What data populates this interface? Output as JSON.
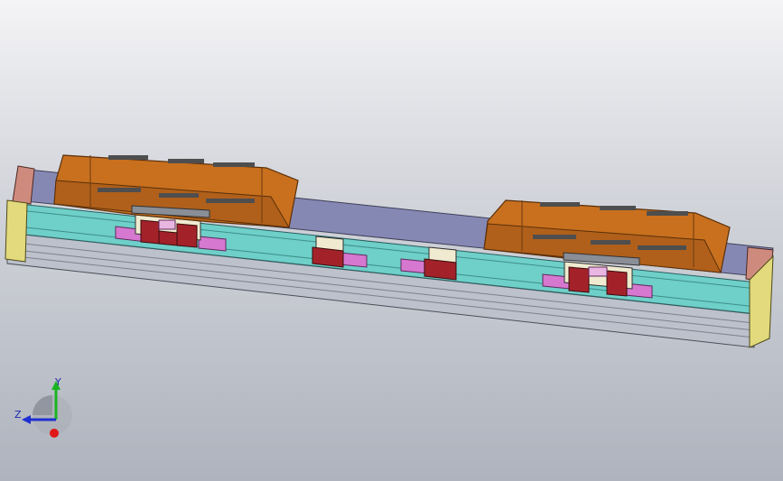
{
  "scene": {
    "description_colors": {
      "carriage_orange": "#c8701e",
      "rail_teal": "#6fcfc9",
      "base_gray": "#bcc1cc",
      "cover_purple": "#8688b4",
      "block_red": "#a3222a",
      "pad_pink": "#d678cf",
      "endcap_yellow": "#e2da7c",
      "endplate_salmon": "#cf8a7e"
    }
  },
  "triad": {
    "y_label": "Y",
    "z_label": "Z",
    "y_color": "#19b51f",
    "z_color": "#1f2fd0",
    "x_color": "#e01818"
  }
}
